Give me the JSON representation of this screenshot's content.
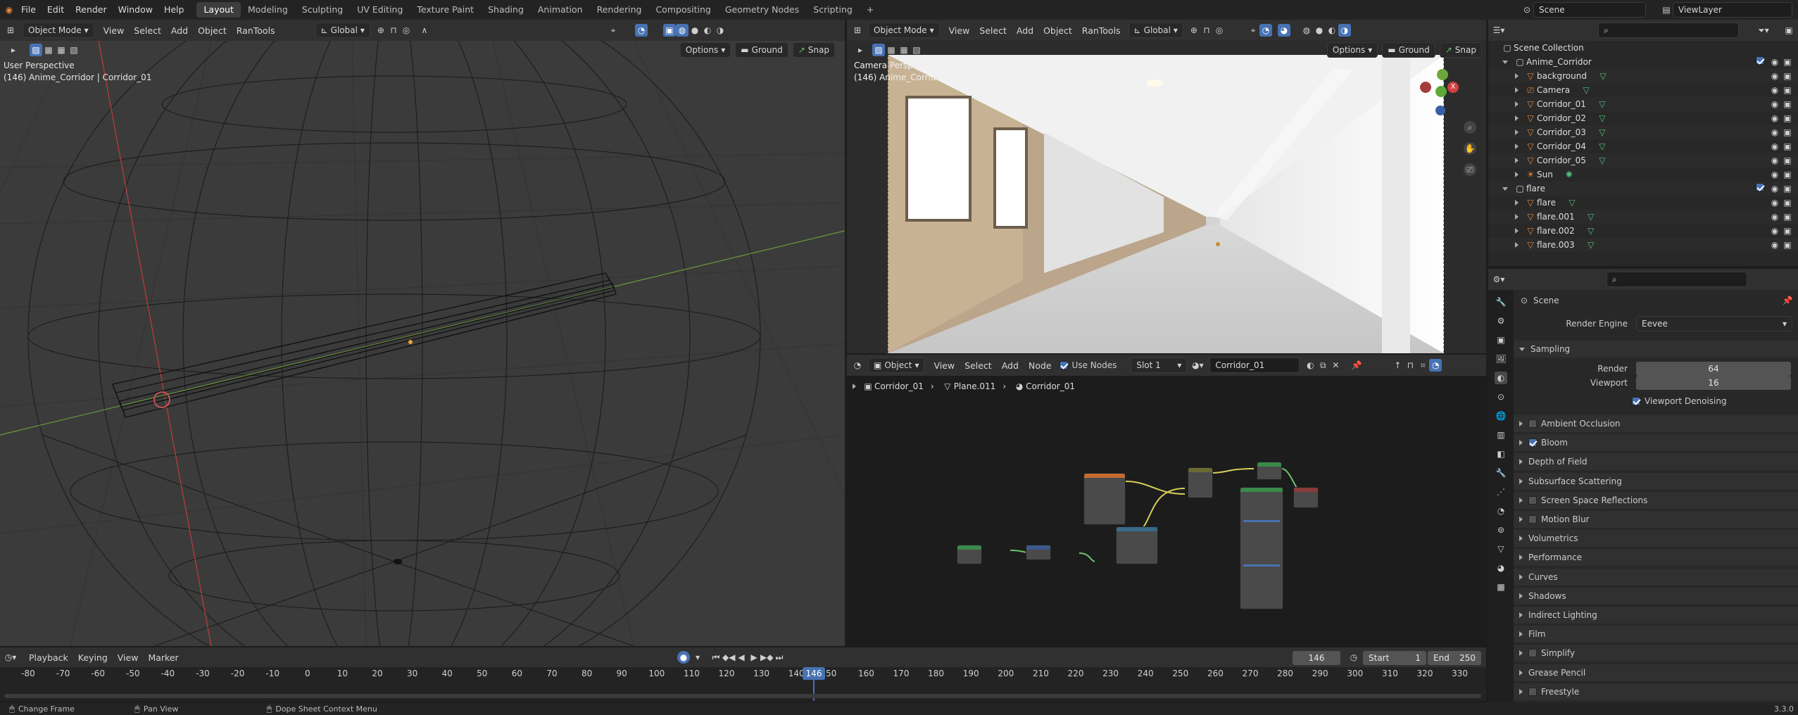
{
  "topbar": {
    "menus": [
      "File",
      "Edit",
      "Render",
      "Window",
      "Help"
    ],
    "workspaces": [
      "Layout",
      "Modeling",
      "Sculpting",
      "UV Editing",
      "Texture Paint",
      "Shading",
      "Animation",
      "Rendering",
      "Compositing",
      "Geometry Nodes",
      "Scripting"
    ],
    "active_workspace": "Layout",
    "add_tab": "+",
    "scene": "Scene",
    "view_layer": "ViewLayer"
  },
  "left_viewport": {
    "mode": "Object Mode",
    "menus": [
      "View",
      "Select",
      "Add",
      "Object",
      "RanTools"
    ],
    "transform": "Global",
    "options": "Options",
    "ground": "Ground",
    "snap": "Snap",
    "title": "User Perspective",
    "subtitle": "(146) Anime_Corridor | Corridor_01"
  },
  "right_viewport": {
    "mode": "Object Mode",
    "menus": [
      "View",
      "Select",
      "Add",
      "Object",
      "RanTools"
    ],
    "transform": "Global",
    "options": "Options",
    "ground": "Ground",
    "snap": "Snap",
    "title": "Camera Perspective",
    "subtitle": "(146) Anime_Corridor | Corridor_01"
  },
  "node_editor": {
    "type": "Object",
    "menus": [
      "View",
      "Select",
      "Add",
      "Node"
    ],
    "use_nodes": "Use Nodes",
    "slot": "Slot 1",
    "material": "Corridor_01",
    "breadcrumb": [
      "Corridor_01",
      "Plane.011",
      "Corridor_01"
    ]
  },
  "outliner": {
    "root": "Scene Collection",
    "items": [
      {
        "name": "Anime_Corridor",
        "kind": "collection",
        "level": 0
      },
      {
        "name": "background",
        "kind": "mesh",
        "level": 1
      },
      {
        "name": "Camera",
        "kind": "camera",
        "level": 1
      },
      {
        "name": "Corridor_01",
        "kind": "mesh",
        "level": 1
      },
      {
        "name": "Corridor_02",
        "kind": "mesh",
        "level": 1
      },
      {
        "name": "Corridor_03",
        "kind": "mesh",
        "level": 1
      },
      {
        "name": "Corridor_04",
        "kind": "mesh",
        "level": 1
      },
      {
        "name": "Corridor_05",
        "kind": "mesh",
        "level": 1
      },
      {
        "name": "Sun",
        "kind": "light",
        "level": 1
      },
      {
        "name": "flare",
        "kind": "collection",
        "level": 0
      },
      {
        "name": "flare",
        "kind": "mesh",
        "level": 1
      },
      {
        "name": "flare.001",
        "kind": "mesh",
        "level": 1
      },
      {
        "name": "flare.002",
        "kind": "mesh",
        "level": 1
      },
      {
        "name": "flare.003",
        "kind": "mesh",
        "level": 1
      }
    ]
  },
  "properties": {
    "context": "Scene",
    "render_engine_label": "Render Engine",
    "render_engine": "Eevee",
    "sampling": "Sampling",
    "render_label": "Render",
    "render_value": "64",
    "viewport_label": "Viewport",
    "viewport_value": "16",
    "denoising": "Viewport Denoising",
    "panels": [
      {
        "name": "Ambient Occlusion",
        "check": true,
        "on": false
      },
      {
        "name": "Bloom",
        "check": true,
        "on": true
      },
      {
        "name": "Depth of Field",
        "check": false,
        "on": false
      },
      {
        "name": "Subsurface Scattering",
        "check": false,
        "on": false
      },
      {
        "name": "Screen Space Reflections",
        "check": true,
        "on": false
      },
      {
        "name": "Motion Blur",
        "check": true,
        "on": false
      },
      {
        "name": "Volumetrics",
        "check": false,
        "on": false
      },
      {
        "name": "Performance",
        "check": false,
        "on": false
      },
      {
        "name": "Curves",
        "check": false,
        "on": false
      },
      {
        "name": "Shadows",
        "check": false,
        "on": false
      },
      {
        "name": "Indirect Lighting",
        "check": false,
        "on": false
      },
      {
        "name": "Film",
        "check": false,
        "on": false
      },
      {
        "name": "Simplify",
        "check": true,
        "on": false
      },
      {
        "name": "Grease Pencil",
        "check": false,
        "on": false
      },
      {
        "name": "Freestyle",
        "check": true,
        "on": false
      }
    ]
  },
  "timeline": {
    "menus": [
      "Playback",
      "Keying",
      "View",
      "Marker"
    ],
    "current_frame": "146",
    "start_label": "Start",
    "start": "1",
    "end_label": "End",
    "end": "250",
    "ticks": [
      "-80",
      "-70",
      "-60",
      "-50",
      "-40",
      "-30",
      "-20",
      "-10",
      "0",
      "10",
      "20",
      "30",
      "40",
      "50",
      "60",
      "70",
      "80",
      "90",
      "100",
      "110",
      "120",
      "130",
      "140",
      "50",
      "160",
      "170",
      "180",
      "190",
      "200",
      "210",
      "220",
      "230",
      "240",
      "250",
      "260",
      "270",
      "280",
      "290",
      "300",
      "310",
      "320",
      "330"
    ],
    "playhead": "146"
  },
  "statusbar": {
    "left": "Change Frame",
    "middle": "Pan View",
    "right": "Dope Sheet Context Menu",
    "version": "3.3.0"
  },
  "colors": {
    "accent": "#4772b3",
    "mesh_icon": "#e6883a",
    "data_icon": "#57c07e"
  }
}
